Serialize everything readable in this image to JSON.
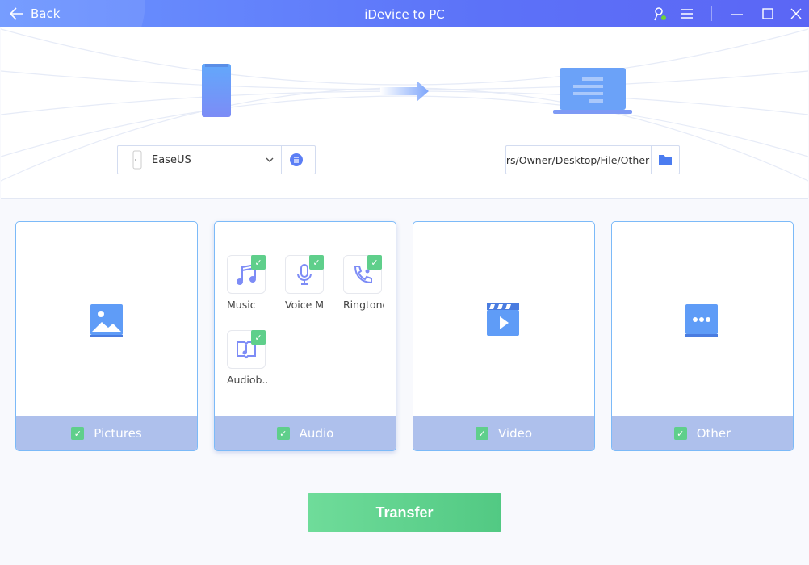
{
  "titlebar": {
    "back_label": "Back",
    "title": "iDevice to PC"
  },
  "source": {
    "device_name": "EaseUS"
  },
  "destination": {
    "path": "ers/Owner/Desktop/File/Other"
  },
  "categories": [
    {
      "label": "Pictures",
      "checked": true
    },
    {
      "label": "Audio",
      "checked": true,
      "items": [
        {
          "label": "Music"
        },
        {
          "label": "Voice M.."
        },
        {
          "label": "Ringtone"
        },
        {
          "label": "Audiob.."
        }
      ]
    },
    {
      "label": "Video",
      "checked": true
    },
    {
      "label": "Other",
      "checked": true
    }
  ],
  "transfer_label": "Transfer",
  "colors": {
    "accent": "#5b72f8",
    "check": "#5fcf8b",
    "card_footer": "#aec0ec"
  }
}
